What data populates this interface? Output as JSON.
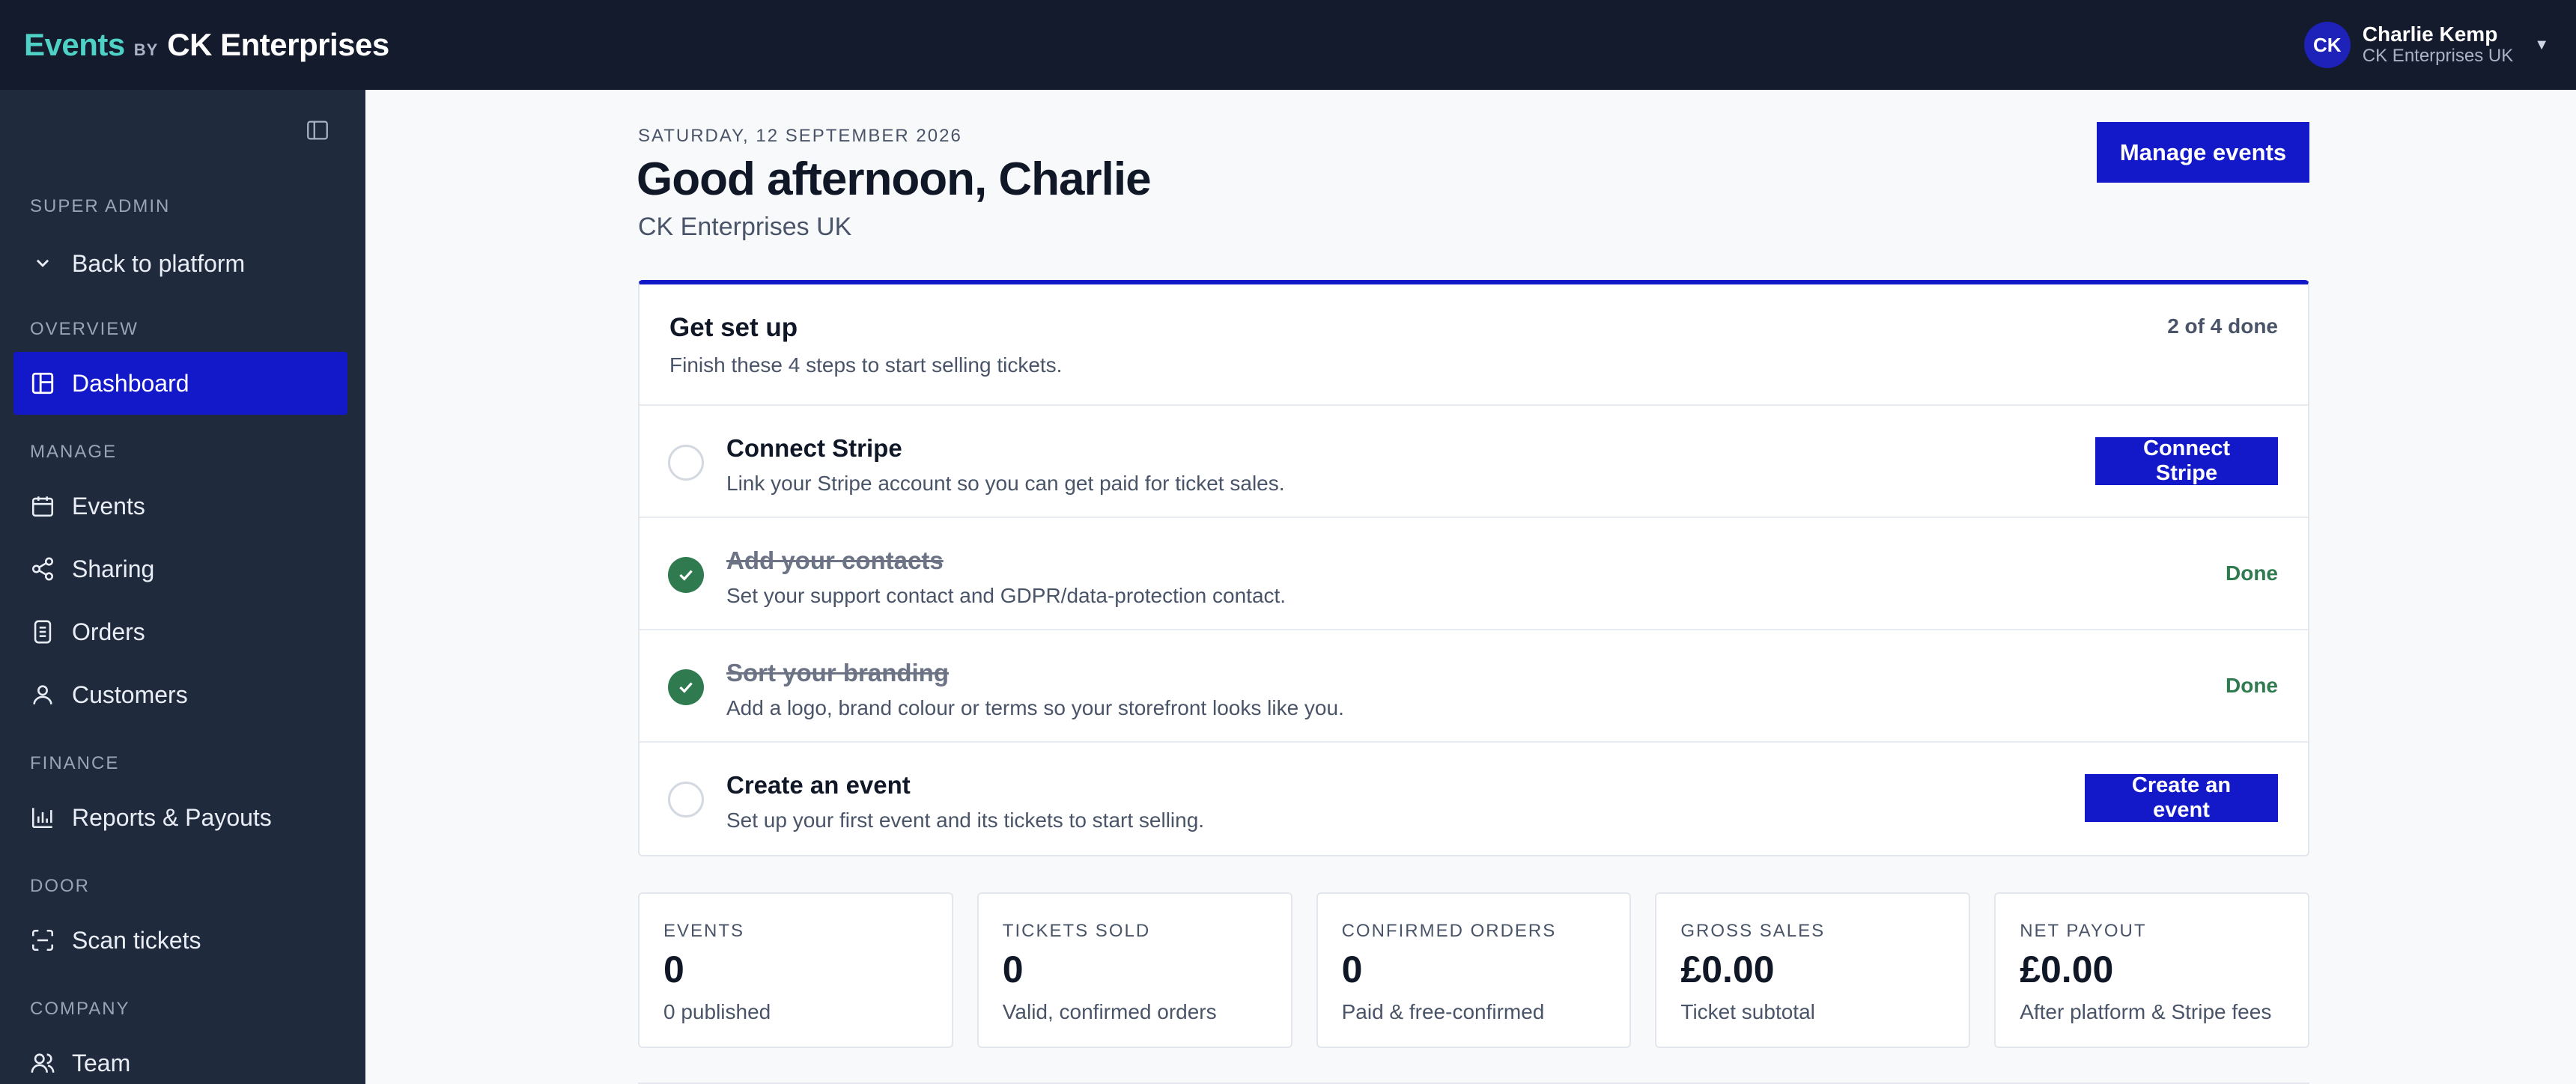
{
  "brand": {
    "name": "Events",
    "by": "BY",
    "company": "CK Enterprises"
  },
  "user": {
    "initials": "CK",
    "name": "Charlie Kemp",
    "org": "CK Enterprises UK"
  },
  "sidebar": {
    "sections": [
      {
        "label": "SUPER ADMIN",
        "items": [
          {
            "label": "Back to platform",
            "icon": "chevron-down-icon"
          }
        ]
      },
      {
        "label": "OVERVIEW",
        "items": [
          {
            "label": "Dashboard",
            "icon": "dashboard-icon",
            "active": true
          }
        ]
      },
      {
        "label": "MANAGE",
        "items": [
          {
            "label": "Events",
            "icon": "calendar-icon"
          },
          {
            "label": "Sharing",
            "icon": "share-icon"
          },
          {
            "label": "Orders",
            "icon": "receipt-icon"
          },
          {
            "label": "Customers",
            "icon": "user-icon"
          }
        ]
      },
      {
        "label": "FINANCE",
        "items": [
          {
            "label": "Reports & Payouts",
            "icon": "bar-chart-icon"
          }
        ]
      },
      {
        "label": "DOOR",
        "items": [
          {
            "label": "Scan tickets",
            "icon": "scan-icon"
          }
        ]
      },
      {
        "label": "COMPANY",
        "items": [
          {
            "label": "Team",
            "icon": "team-icon"
          }
        ]
      }
    ]
  },
  "header": {
    "date": "SATURDAY, 12 SEPTEMBER 2026",
    "greeting": "Good afternoon, Charlie",
    "org": "CK Enterprises UK",
    "manage_button": "Manage events"
  },
  "setup": {
    "title": "Get set up",
    "subtitle": "Finish these 4 steps to start selling tickets.",
    "progress": "2 of 4 done",
    "steps": [
      {
        "title": "Connect Stripe",
        "desc": "Link your Stripe account so you can get paid for ticket sales.",
        "done": false,
        "action": "Connect Stripe"
      },
      {
        "title": "Add your contacts",
        "desc": "Set your support contact and GDPR/data-protection contact.",
        "done": true,
        "status": "Done"
      },
      {
        "title": "Sort your branding",
        "desc": "Add a logo, brand colour or terms so your storefront looks like you.",
        "done": true,
        "status": "Done"
      },
      {
        "title": "Create an event",
        "desc": "Set up your first event and its tickets to start selling.",
        "done": false,
        "action": "Create an event"
      }
    ]
  },
  "stats": [
    {
      "label": "EVENTS",
      "value": "0",
      "sub": "0 published"
    },
    {
      "label": "TICKETS SOLD",
      "value": "0",
      "sub": "Valid, confirmed orders"
    },
    {
      "label": "CONFIRMED ORDERS",
      "value": "0",
      "sub": "Paid & free-confirmed"
    },
    {
      "label": "GROSS SALES",
      "value": "£0.00",
      "sub": "Ticket subtotal"
    },
    {
      "label": "NET PAYOUT",
      "value": "£0.00",
      "sub": "After platform & Stripe fees"
    }
  ],
  "colors": {
    "accent": "#1318c9",
    "brand_teal": "#4fd1c5",
    "topbar": "#141b2d",
    "sidebar": "#1f2a3d",
    "done_green": "#2f7a4f"
  }
}
